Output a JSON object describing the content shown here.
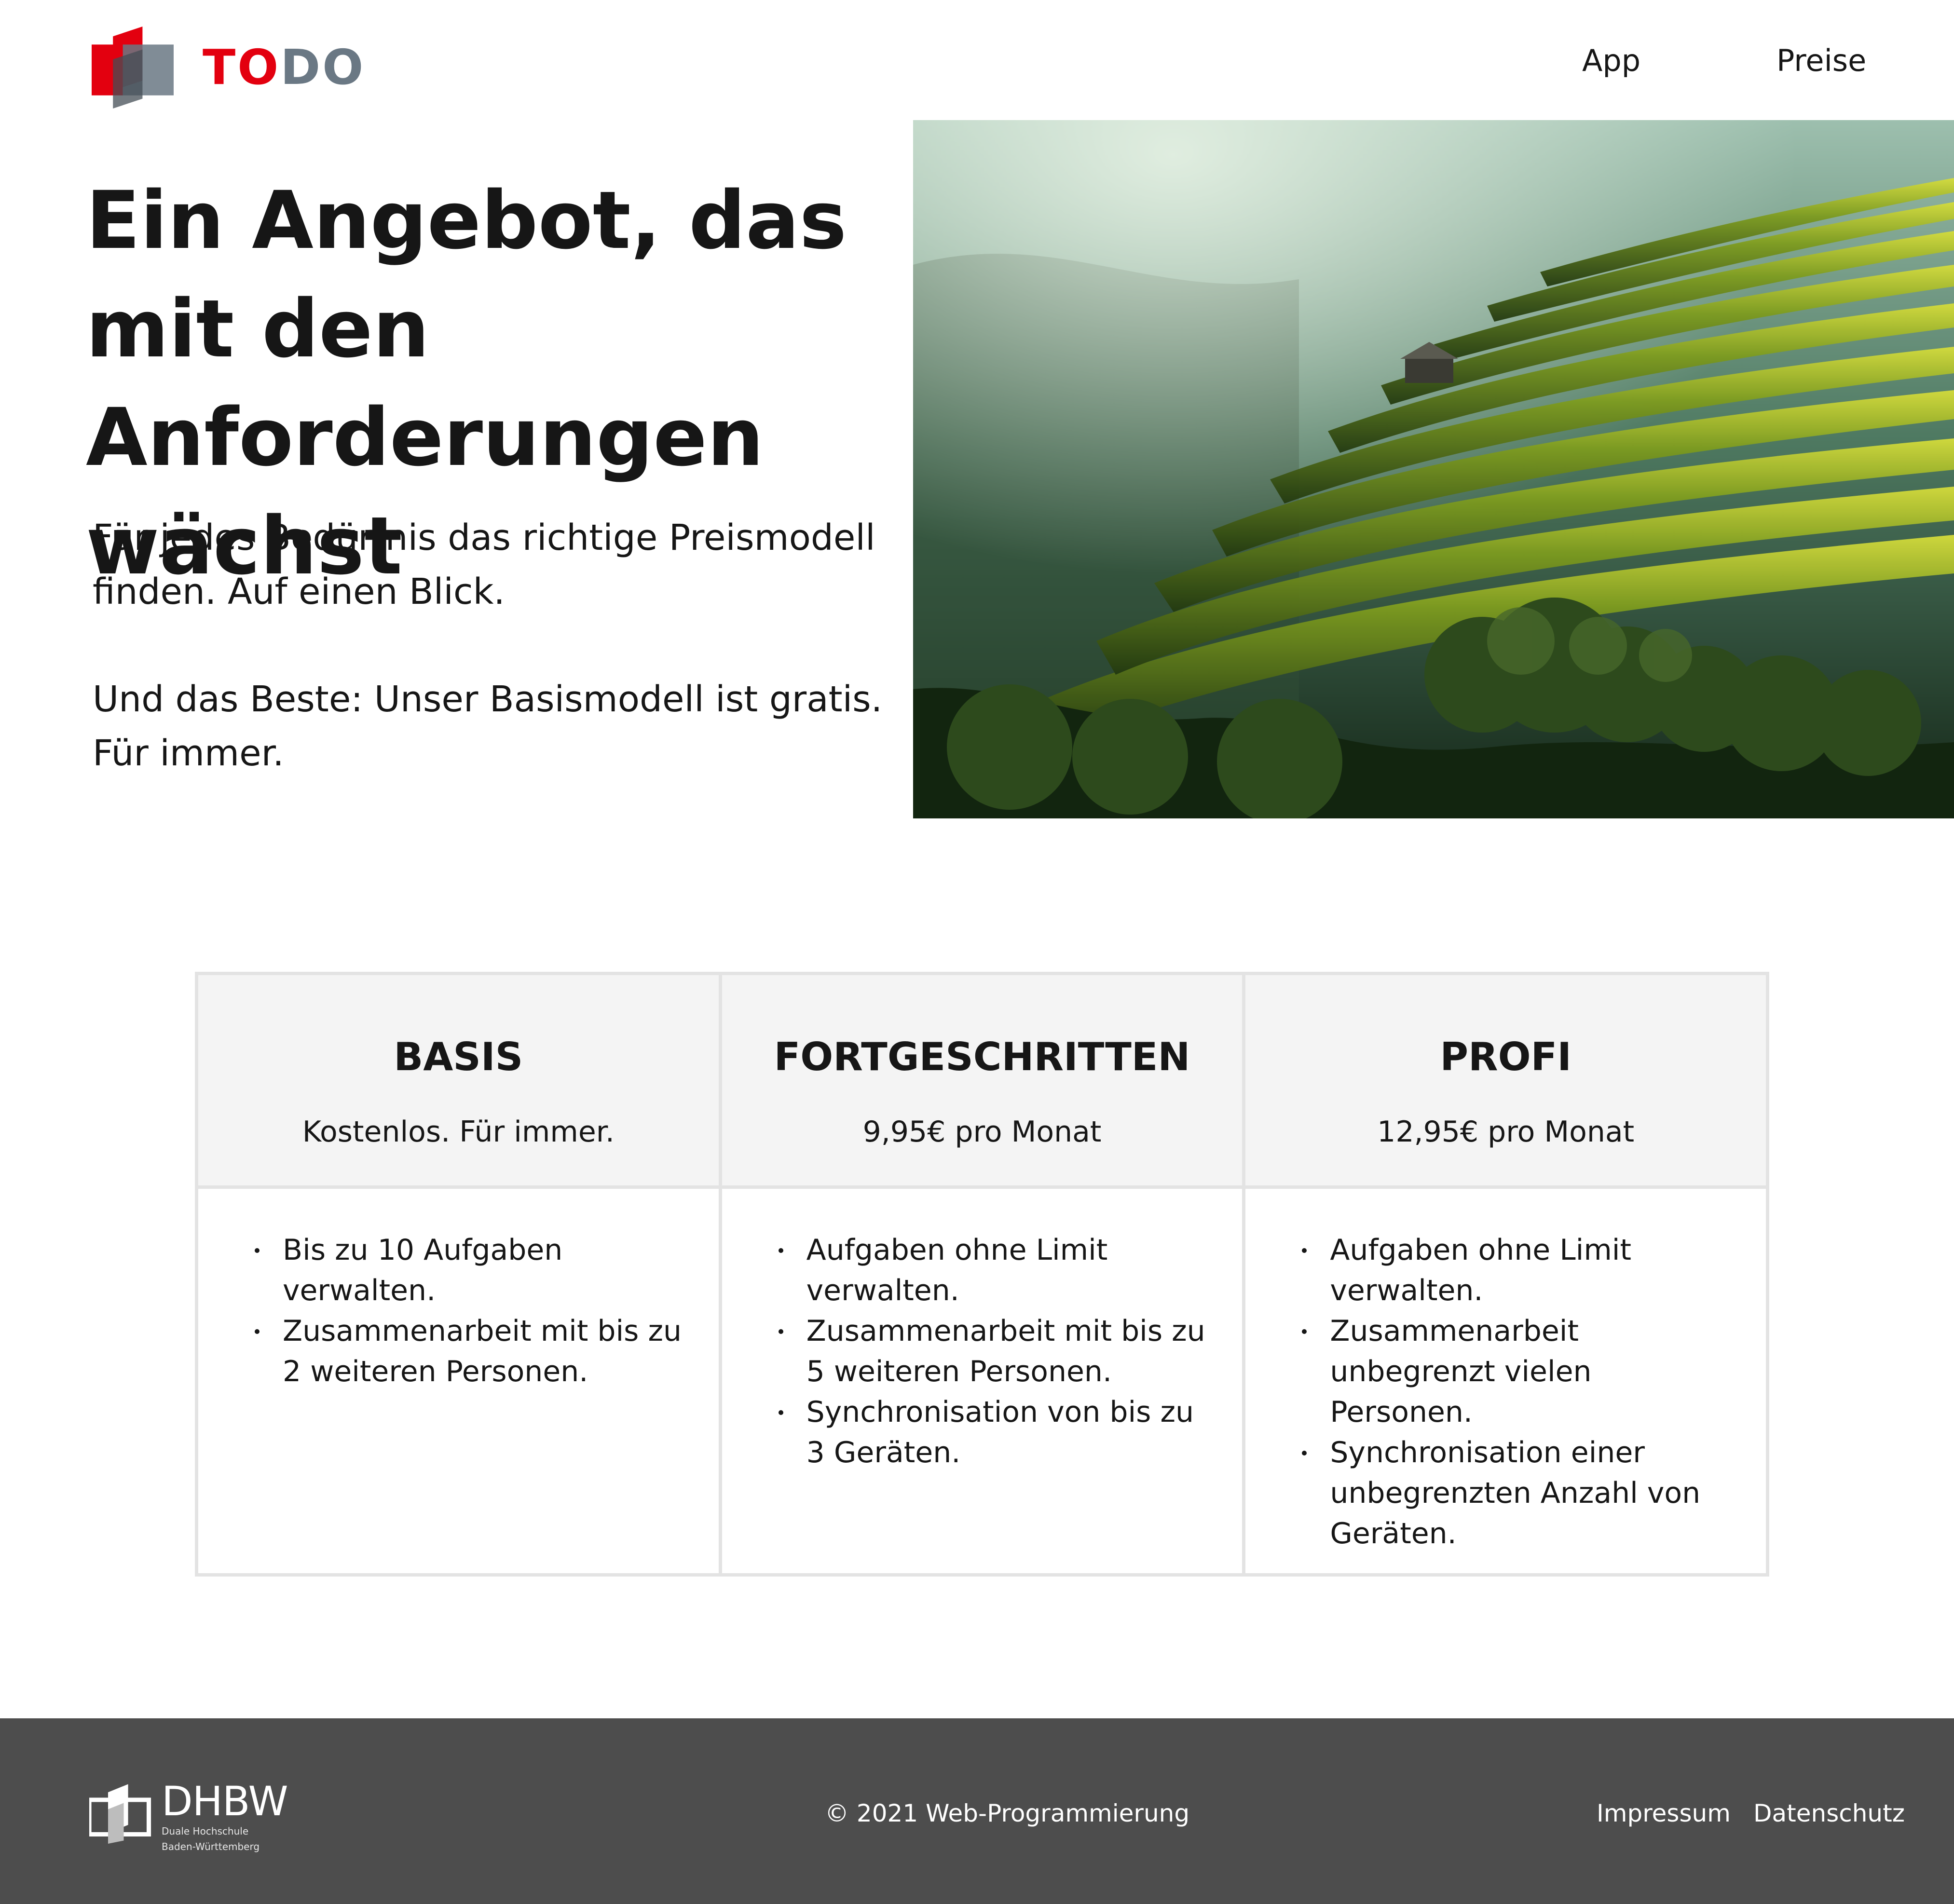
{
  "header": {
    "logo": {
      "text_part1": "TO",
      "text_part2": "DO",
      "colors": {
        "red": "#e3000f",
        "gray": "#6a7884"
      }
    },
    "nav": [
      {
        "label": "App"
      },
      {
        "label": "Preise"
      }
    ]
  },
  "hero": {
    "title": "Ein Angebot, das mit den Anforderungen wächst",
    "paragraph1": "Für jedes Bedürfnis das richtige Preismodell finden. Auf einen Blick.",
    "paragraph2": "Und das Beste: Unser Basismodell ist gratis. Für immer.",
    "image": "rice-terraces-photo"
  },
  "pricing": {
    "plans": [
      {
        "name": "BASIS",
        "price": "Kostenlos. Für immer.",
        "features": [
          "Bis zu 10 Aufgaben verwalten.",
          "Zusammenarbeit mit bis zu 2 weiteren Personen."
        ]
      },
      {
        "name": "FORTGESCHRITTEN",
        "price": "9,95€ pro Monat",
        "features": [
          "Aufgaben ohne Limit verwalten.",
          "Zusammenarbeit mit bis zu 5 weiteren Personen.",
          "Synchronisation von bis zu 3 Geräten."
        ]
      },
      {
        "name": "PROFI",
        "price": "12,95€ pro Monat",
        "features": [
          "Aufgaben ohne Limit verwalten.",
          "Zusammenarbeit unbegrenzt vielen Personen.",
          "Synchronisation einer unbegrenzten Anzahl von Geräten."
        ]
      }
    ]
  },
  "footer": {
    "logo": {
      "name": "DHBW",
      "line1": "Duale Hochschule",
      "line2": "Baden-Württemberg"
    },
    "copyright": "© 2021 Web-Programmierung",
    "links": [
      {
        "label": "Impressum"
      },
      {
        "label": "Datenschutz"
      }
    ],
    "background": "#4d4d4d"
  }
}
